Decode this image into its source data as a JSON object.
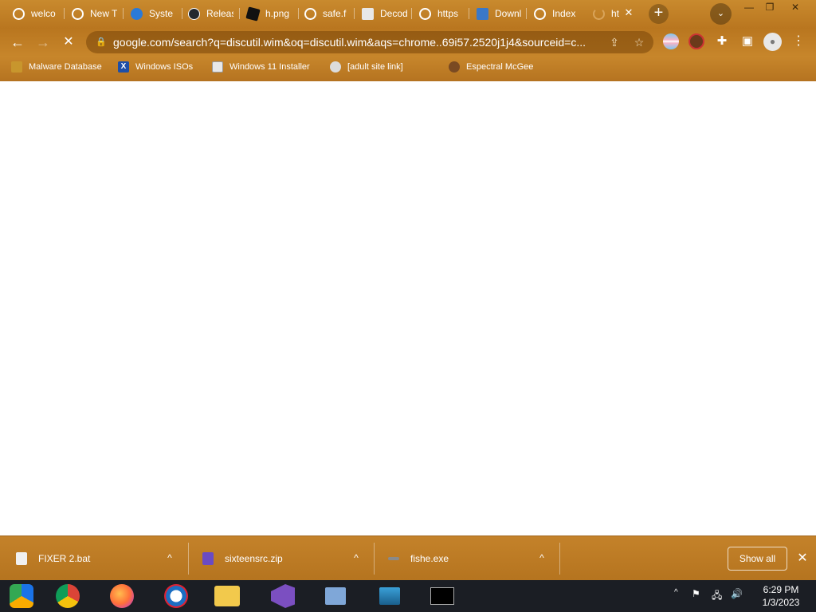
{
  "window": {
    "minimize_glyph": "—",
    "restore_glyph": "❐",
    "close_glyph": "✕"
  },
  "tabs": [
    {
      "label": "welco",
      "icon": "chrome-globe-icon",
      "color": "#ffffff"
    },
    {
      "label": "New T",
      "icon": "chrome-globe-icon",
      "color": "#ffffff"
    },
    {
      "label": "Syste",
      "icon": "cloud-icon",
      "color": "#2a7ad8"
    },
    {
      "label": "Releas",
      "icon": "github-icon",
      "color": "#24292e"
    },
    {
      "label": "h.png",
      "icon": "roblox-icon",
      "color": "#111111"
    },
    {
      "label": "safe.f",
      "icon": "chrome-globe-icon",
      "color": "#ffffff"
    },
    {
      "label": "Decod",
      "icon": "image-icon",
      "color": "#e8e8e8"
    },
    {
      "label": "https",
      "icon": "chrome-globe-icon",
      "color": "#ffffff"
    },
    {
      "label": "Downl",
      "icon": "doc-icon",
      "color": "#3a78c8"
    },
    {
      "label": "Index",
      "icon": "chrome-globe-icon",
      "color": "#ffffff"
    },
    {
      "label": "ht",
      "icon": "loading-icon",
      "color": "#d9a45a"
    }
  ],
  "tab_close_glyph": "✕",
  "new_tab_glyph": "+",
  "tab_search_glyph": "⌄",
  "toolbar": {
    "back_glyph": "←",
    "forward_glyph": "→",
    "reload_glyph": "✕",
    "lock_glyph": "🔒",
    "url": "google.com/search?q=discutil.wim&oq=discutil.wim&aqs=chrome..69i57.2520j1j4&sourceid=c...",
    "share_glyph": "⇪",
    "star_glyph": "☆",
    "extensions_glyph": "✚",
    "sidepanel_glyph": "▣",
    "profile_glyph": "●",
    "menu_glyph": "⋮"
  },
  "bookmarks": [
    {
      "label": "Malware Database",
      "icon": "folder-icon",
      "color": "#c8962d"
    },
    {
      "label": "Windows ISOs",
      "icon": "x-logo-icon",
      "color": "#1d4fa8"
    },
    {
      "label": "Windows 11 Installer",
      "icon": "image-icon",
      "color": "#e8e8e8"
    },
    {
      "label": "[adult site link]",
      "icon": "puzzle-icon",
      "color": "#dcdcdc"
    },
    {
      "label": "Espectral McGee",
      "icon": "avatar-icon",
      "color": "#7a4a22"
    }
  ],
  "downloads": [
    {
      "filename": "FIXER 2.bat",
      "icon": "batch-file-icon",
      "color": "#f0f0f0"
    },
    {
      "filename": "sixteensrc.zip",
      "icon": "zip-file-icon",
      "color": "#6a4bc4"
    },
    {
      "filename": "fishe.exe",
      "icon": "exe-file-icon",
      "color": "#8a8a8a"
    }
  ],
  "downloads_caret": "^",
  "show_all_label": "Show all",
  "shelf_close_glyph": "✕",
  "taskbar": {
    "apps": [
      {
        "name": "chrome-canary-icon",
        "color": "#1a73e8"
      },
      {
        "name": "chrome-icon",
        "color": "#4caf50"
      },
      {
        "name": "firefox-icon",
        "color": "#ff7139"
      },
      {
        "name": "opera-icon",
        "color": "#1b6ec2"
      },
      {
        "name": "file-explorer-icon",
        "color": "#f2c94c"
      },
      {
        "name": "visual-studio-icon",
        "color": "#7b4fc1"
      },
      {
        "name": "task-view-icon",
        "color": "#7fa7d8"
      },
      {
        "name": "installer-icon",
        "color": "#3aa0d8"
      },
      {
        "name": "cmd-icon",
        "color": "#000000"
      }
    ],
    "tray_caret": "^",
    "flag_glyph": "⚑",
    "network_glyph": "🖧",
    "volume_glyph": "🔊",
    "time": "6:29 PM",
    "date": "1/3/2023"
  }
}
